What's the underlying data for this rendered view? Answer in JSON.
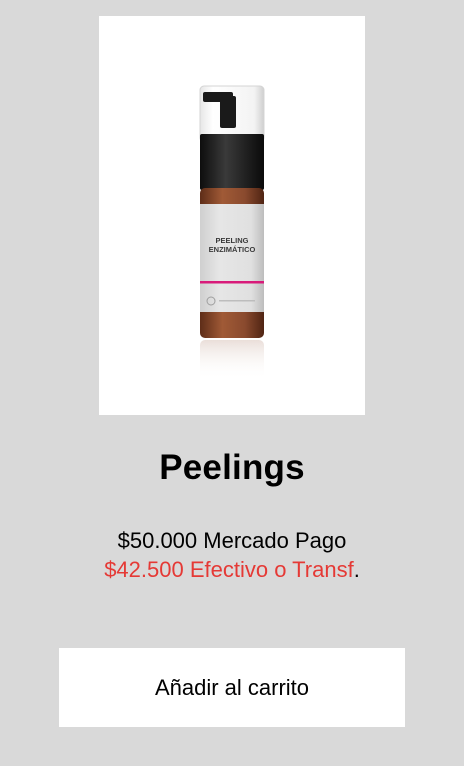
{
  "product": {
    "image_label_line1": "PEELING",
    "image_label_line2": "ENZIMÁTICO",
    "title": "Peelings",
    "price_card": "$50.000 Mercado Pago",
    "price_transfer": "$42.500 Efectivo o Transf",
    "price_transfer_suffix": ".",
    "add_to_cart_label": "Añadir al carrito"
  },
  "colors": {
    "background": "#d9d9d9",
    "card": "#ffffff",
    "price_transfer": "#e53935",
    "bottle_amber": "#8a4a2e",
    "label_accent": "#d81b7a"
  }
}
